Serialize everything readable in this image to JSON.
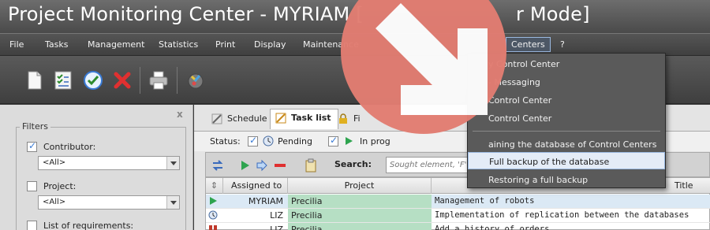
{
  "window": {
    "title": "Project Monitoring Center - MYRIAM [",
    "title_tail": "r Mode]"
  },
  "menu": {
    "items": [
      "File",
      "Tasks",
      "Management",
      "Statistics",
      "Print",
      "Display",
      "Maintenance",
      "Centers",
      "?"
    ]
  },
  "toolbar": {
    "icons": [
      "new-document-icon",
      "task-list-icon",
      "validate-icon",
      "delete-icon",
      "print-icon",
      "tools-icon"
    ]
  },
  "dropdown": {
    "items": [
      "y Control Center",
      "- Messaging",
      "Control Center",
      "Control Center",
      "aining the database of Control Centers",
      "Full backup of the database",
      "Restoring a full backup"
    ],
    "highlighted_index": 5
  },
  "filters": {
    "legend": "Filters",
    "contributor_label": "Contributor:",
    "contributor_value": "<All>",
    "project_label": "Project:",
    "project_value": "<All>",
    "requirements_label": "List of requirements:",
    "close_symbol": "x"
  },
  "tabs": {
    "schedule": "Schedule",
    "task_list": "Task list",
    "third": "Fi"
  },
  "status": {
    "label": "Status:",
    "pending": "Pending",
    "in_progress": "In prog"
  },
  "search": {
    "label": "Search:",
    "placeholder": "Sought element, 'F'"
  },
  "grid": {
    "headers": {
      "assigned_to": "Assigned to",
      "project": "Project",
      "title": "Title"
    },
    "rows": [
      {
        "assigned": "MYRIAM",
        "project": "Precilia",
        "task": "Management of robots"
      },
      {
        "assigned": "LIZ",
        "project": "Precilia",
        "task": "Implementation of replication between the databases"
      },
      {
        "assigned": "LIZ",
        "project": "Precilia",
        "task": "Add a history of orders"
      }
    ]
  },
  "colors": {
    "project_cell": "#b6dfc4",
    "selected_row": "#dbe9f5",
    "overlay_badge": "#e27d72"
  }
}
